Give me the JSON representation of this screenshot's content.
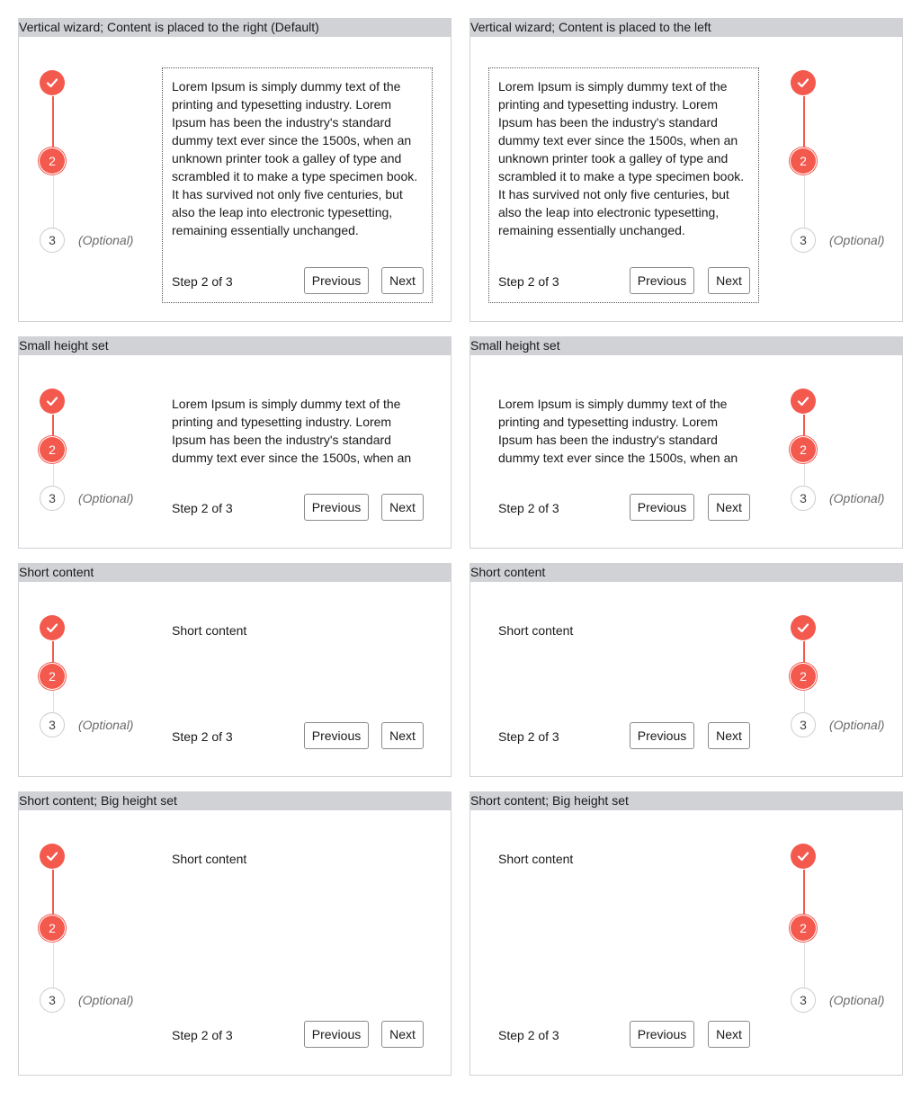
{
  "panels": [
    {
      "title": "Vertical wizard; Content is placed to the right (Default)"
    },
    {
      "title": "Vertical wizard; Content is placed to the left"
    },
    {
      "title": "Small height set"
    },
    {
      "title": "Small height set"
    },
    {
      "title": "Short content"
    },
    {
      "title": "Short content"
    },
    {
      "title": "Short content; Big height set"
    },
    {
      "title": "Short content; Big height set"
    }
  ],
  "wizard": {
    "step_current": "2",
    "step_next": "3",
    "optional_label": "(Optional)",
    "step_indicator": "Step 2 of 3",
    "previous_label": "Previous",
    "next_label": "Next",
    "check_icon": "check-icon"
  },
  "content": {
    "long": "Lorem Ipsum is simply dummy text of the printing and typesetting industry. Lorem Ipsum has been the industry's standard dummy text ever since the 1500s, when an unknown printer took a galley of type and scrambled it to make a type specimen book. It has survived not only five centuries, but also the leap into electronic typesetting, remaining essentially unchanged.",
    "short": "Short content"
  },
  "colors": {
    "accent": "#f4594e",
    "header_bg": "#d0d2d6",
    "border": "#d0d2d6"
  }
}
